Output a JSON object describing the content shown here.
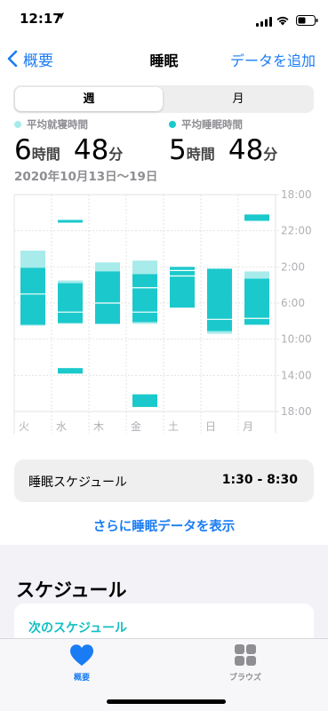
{
  "status": {
    "time": "12:17",
    "location_icon": "location-arrow-icon"
  },
  "nav": {
    "back_label": "概要",
    "title": "睡眠",
    "action_label": "データを追加"
  },
  "segments": [
    {
      "label": "週",
      "selected": true
    },
    {
      "label": "月",
      "selected": false
    }
  ],
  "averages": {
    "in_bed": {
      "label": "平均就寝時間",
      "hours": "6",
      "hours_unit": "時間",
      "minutes": "48",
      "minutes_unit": "分",
      "color": "#a8ebeb"
    },
    "asleep": {
      "label": "平均睡眠時間",
      "hours": "5",
      "hours_unit": "時間",
      "minutes": "48",
      "minutes_unit": "分",
      "color": "#1bc9cc"
    }
  },
  "date_range": "2020年10月13日〜19日",
  "chart_data": {
    "type": "range-bar",
    "categories": [
      "火",
      "水",
      "木",
      "金",
      "土",
      "日",
      "月"
    ],
    "y_tick_labels": [
      "18:00",
      "22:00",
      "2:00",
      "6:00",
      "10:00",
      "14:00",
      "18:00"
    ],
    "y_unit": "hours since 18:00",
    "ylim": [
      0,
      24
    ],
    "grid": true,
    "in_bed_color": "#a8ebeb",
    "asleep_color": "#1bc9cc",
    "days": [
      {
        "day": "火",
        "in_bed": [
          [
            6.2,
            14.5
          ]
        ],
        "asleep": [
          [
            8.1,
            14.4
          ]
        ],
        "breaks": [
          11.0
        ]
      },
      {
        "day": "水",
        "in_bed": [
          [
            2.8,
            3.1
          ],
          [
            9.5,
            14.3
          ],
          [
            19.2,
            19.8
          ]
        ],
        "asleep": [
          [
            2.8,
            3.1
          ],
          [
            9.8,
            14.2
          ],
          [
            19.2,
            19.8
          ]
        ],
        "breaks": [
          13.0
        ]
      },
      {
        "day": "木",
        "in_bed": [
          [
            7.5,
            14.3
          ]
        ],
        "asleep": [
          [
            8.5,
            14.3
          ]
        ],
        "breaks": [
          12.0
        ]
      },
      {
        "day": "金",
        "in_bed": [
          [
            7.3,
            14.3
          ]
        ],
        "asleep": [
          [
            8.8,
            14.1
          ]
        ],
        "breaks": [
          10.3,
          13.0
        ],
        "extra": [
          [
            22.1,
            23.5
          ]
        ]
      },
      {
        "day": "土",
        "in_bed": [
          [
            8.0,
            12.5
          ]
        ],
        "asleep": [
          [
            8.0,
            12.5
          ]
        ],
        "breaks": [
          8.4,
          9.0
        ]
      },
      {
        "day": "日",
        "in_bed": [
          [
            8.2,
            15.4
          ]
        ],
        "asleep": [
          [
            8.2,
            15.1
          ]
        ],
        "breaks": [
          13.8
        ]
      },
      {
        "day": "月",
        "in_bed": [
          [
            2.2,
            2.9
          ],
          [
            8.5,
            14.4
          ]
        ],
        "asleep": [
          [
            2.2,
            2.9
          ],
          [
            9.3,
            14.4
          ]
        ],
        "breaks": [
          13.7
        ]
      }
    ]
  },
  "schedule": {
    "label": "睡眠スケジュール",
    "value": "1:30 - 8:30"
  },
  "more_link": "さらに睡眠データを表示",
  "section_title": "スケジュール",
  "next_schedule_label": "次のスケジュール",
  "tabbar": {
    "summary_label": "概要",
    "browse_label": "ブラウズ",
    "summary_icon": "heart-icon",
    "browse_icon": "grid-icon",
    "accent": "#1a7cf5"
  }
}
